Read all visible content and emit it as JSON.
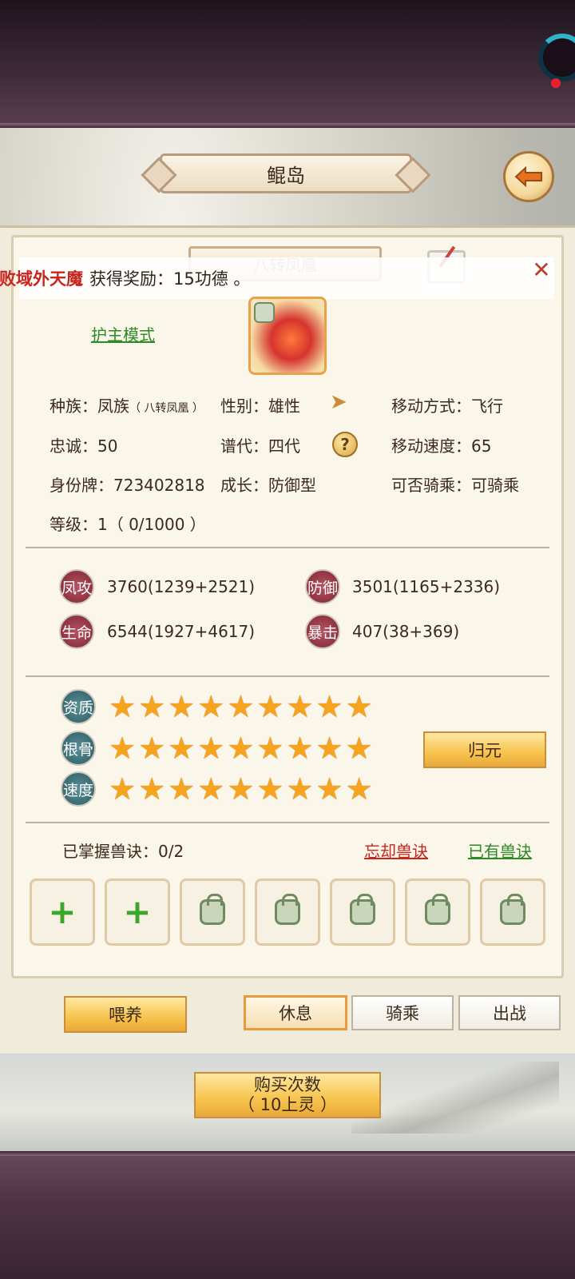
{
  "header": {
    "title": "鲲岛"
  },
  "pet": {
    "name": "八转凤凰",
    "guard_mode": "护主模式"
  },
  "notification": {
    "highlight": "击败域外天魔",
    "rest": "获得奖励：15功德 。",
    "close": "✕"
  },
  "info": {
    "race_label": "种族：",
    "race_value": "凤族",
    "race_sub": "（ 八转凤凰 ）",
    "gender": "性别：雄性",
    "move_mode": "移动方式：飞行",
    "loyalty": "忠诚：50",
    "generation": "谱代：四代",
    "move_speed": "移动速度：65",
    "id_tag": "身份牌：723402818",
    "growth": "成长：防御型",
    "rideable": "可否骑乘：可骑乘",
    "level": "等级：1（ 0/1000 ）",
    "help": "?"
  },
  "stats": [
    {
      "badge": "凤攻",
      "value": "3760(1239+2521)"
    },
    {
      "badge": "防御",
      "value": "3501(1165+2336)"
    },
    {
      "badge": "生命",
      "value": "6544(1927+4617)"
    },
    {
      "badge": "暴击",
      "value": "407(38+369)"
    }
  ],
  "ratings": [
    {
      "label": "资质",
      "stars": 9,
      "max": 9
    },
    {
      "label": "根骨",
      "stars": 9,
      "max": 9
    },
    {
      "label": "速度",
      "stars": 9,
      "max": 9
    }
  ],
  "buttons": {
    "reset": "归元",
    "feed": "喂养",
    "rest": "休息",
    "ride": "骑乘",
    "battle": "出战",
    "buy_line1": "购买次数",
    "buy_line2": "（ 10上灵 ）"
  },
  "skills": {
    "mastered": "已掌握兽诀：0/2",
    "forget": "忘却兽诀",
    "owned": "已有兽诀",
    "slots": [
      "add",
      "add",
      "locked",
      "locked",
      "locked",
      "locked",
      "locked"
    ]
  },
  "colors": {
    "accent": "#f7c34c",
    "link_green": "#2e8a26",
    "link_red": "#c7261e",
    "star": "#f6a31d"
  },
  "icons": {
    "star": "★",
    "plus": "+",
    "back": "back-arrow-icon",
    "lock": "lock-icon"
  }
}
